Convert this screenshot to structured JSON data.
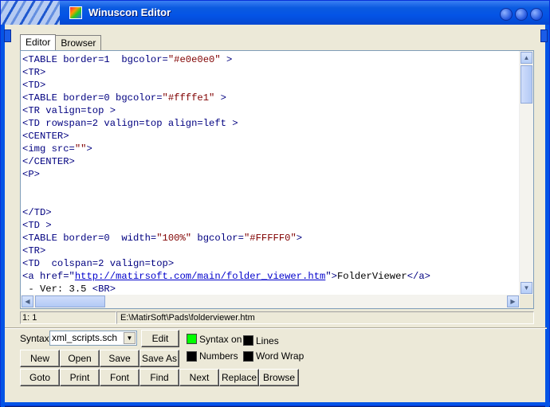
{
  "window": {
    "title": "Winuscon Editor"
  },
  "tabs": [
    {
      "label": "Editor"
    },
    {
      "label": "Browser"
    }
  ],
  "code_lines": [
    [
      {
        "c": "tag",
        "t": "<TABLE border=1  bgcolor="
      },
      {
        "c": "str",
        "t": "\"#e0e0e0\""
      },
      {
        "c": "tag",
        "t": " >"
      }
    ],
    [
      {
        "c": "tag",
        "t": "<TR>"
      }
    ],
    [
      {
        "c": "tag",
        "t": "<TD>"
      }
    ],
    [
      {
        "c": "tag",
        "t": "<TABLE border=0 bgcolor="
      },
      {
        "c": "str",
        "t": "\"#ffffe1\""
      },
      {
        "c": "tag",
        "t": " >"
      }
    ],
    [
      {
        "c": "tag",
        "t": "<TR valign=top >"
      }
    ],
    [
      {
        "c": "tag",
        "t": "<TD rowspan=2 valign=top align=left >"
      }
    ],
    [
      {
        "c": "tag",
        "t": "<CENTER>"
      }
    ],
    [
      {
        "c": "tag",
        "t": "<img src="
      },
      {
        "c": "str",
        "t": "\"\""
      },
      {
        "c": "tag",
        "t": ">"
      }
    ],
    [
      {
        "c": "tag",
        "t": "</CENTER>"
      }
    ],
    [
      {
        "c": "tag",
        "t": "<P>"
      }
    ],
    [],
    [],
    [
      {
        "c": "tag",
        "t": "</TD>"
      }
    ],
    [
      {
        "c": "tag",
        "t": "<TD >"
      }
    ],
    [
      {
        "c": "tag",
        "t": "<TABLE border=0  width="
      },
      {
        "c": "str",
        "t": "\"100%\""
      },
      {
        "c": "tag",
        "t": " bgcolor="
      },
      {
        "c": "str",
        "t": "\"#FFFFF0\""
      },
      {
        "c": "tag",
        "t": ">"
      }
    ],
    [
      {
        "c": "tag",
        "t": "<TR>"
      }
    ],
    [
      {
        "c": "tag",
        "t": "<TD  colspan=2 valign=top>"
      }
    ],
    [
      {
        "c": "tag",
        "t": "<a href=\""
      },
      {
        "c": "url",
        "t": "http://matirsoft.com/main/folder_viewer.htm"
      },
      {
        "c": "tag",
        "t": "\">"
      },
      {
        "c": "txt",
        "t": "FolderViewer"
      },
      {
        "c": "tag",
        "t": "</a>"
      }
    ],
    [
      {
        "c": "txt",
        "t": " - Ver: 3.5 "
      },
      {
        "c": "tag",
        "t": "<BR>"
      }
    ]
  ],
  "status": {
    "position": "1: 1",
    "path": "E:\\MatirSoft\\Pads\\folderviewer.htm"
  },
  "controls": {
    "syntax_label": "Syntax",
    "syntax_value": "xml_scripts.sch",
    "edit_label": "Edit",
    "checks": {
      "syntax_on": {
        "label": "Syntax on",
        "color": "#00ff00"
      },
      "lines": {
        "label": "Lines",
        "color": "#000000"
      },
      "numbers": {
        "label": "Numbers",
        "color": "#000000"
      },
      "word_wrap": {
        "label": "Word Wrap",
        "color": "#000000"
      }
    },
    "row1": [
      "New",
      "Open",
      "Save",
      "Save As"
    ],
    "row2": [
      "Goto",
      "Print",
      "Font",
      "Find",
      "Next",
      "Replace",
      "Browse"
    ]
  }
}
